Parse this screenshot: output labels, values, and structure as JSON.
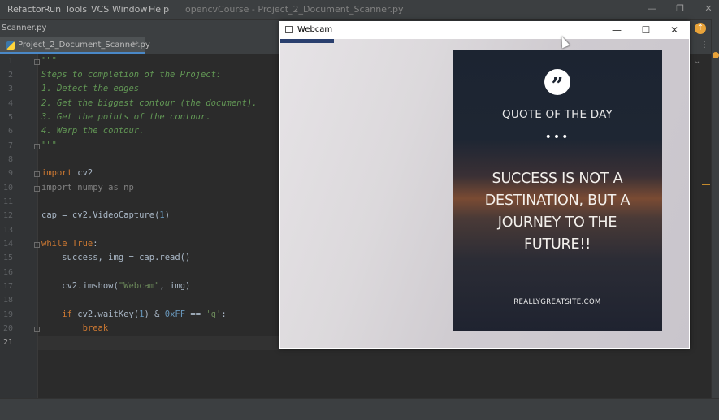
{
  "menubar": {
    "items": [
      "Refactor",
      "Run",
      "Tools",
      "VCS",
      "Window",
      "Help"
    ],
    "title": "opencvCourse - Project_2_Document_Scanner.py"
  },
  "navbar": {
    "crumb": "Scanner.py"
  },
  "tab": {
    "label": "Project_2_Document_Scanner.py"
  },
  "editor": {
    "line_numbers": [
      "1",
      "2",
      "3",
      "4",
      "5",
      "6",
      "7",
      "8",
      "9",
      "10",
      "11",
      "12",
      "13",
      "14",
      "15",
      "16",
      "17",
      "18",
      "19",
      "20",
      "21"
    ],
    "docstring": [
      "\"\"\"",
      "Steps to completion of the Project:",
      "1. Detect the edges",
      "2. Get the biggest contour (the document).",
      "3. Get the points of the contour.",
      "4. Warp the contour.",
      "\"\"\""
    ],
    "code": {
      "l9_kw": "import",
      "l9_rest": " cv2",
      "l10": "import numpy as np",
      "l12": "cap = cv2.VideoCapture(",
      "l12_num": "1",
      "l12_end": ")",
      "l14_kw": "while True",
      "l14_end": ":",
      "l15": "    success, img = cap.read()",
      "l17_a": "    cv2.imshow(",
      "l17_str": "\"Webcam\"",
      "l17_b": ", img)",
      "l19_kw": "    if",
      "l19_a": " cv2.waitKey(",
      "l19_n1": "1",
      "l19_b": ") & ",
      "l19_n2": "0xFF",
      "l19_c": " == ",
      "l19_str": "'q'",
      "l19_d": ":",
      "l20_kw": "        break"
    }
  },
  "webcam": {
    "title": "Webcam",
    "minimize": "—",
    "maximize": "☐",
    "close": "✕",
    "poster": {
      "heading": "QUOTE OF THE DAY",
      "dots": "•••",
      "quote_lines": [
        "SUCCESS IS NOT A",
        "DESTINATION, BUT A",
        "JOURNEY TO THE",
        "FUTURE!!"
      ],
      "site": "REALLYGREATSITE.COM"
    }
  }
}
